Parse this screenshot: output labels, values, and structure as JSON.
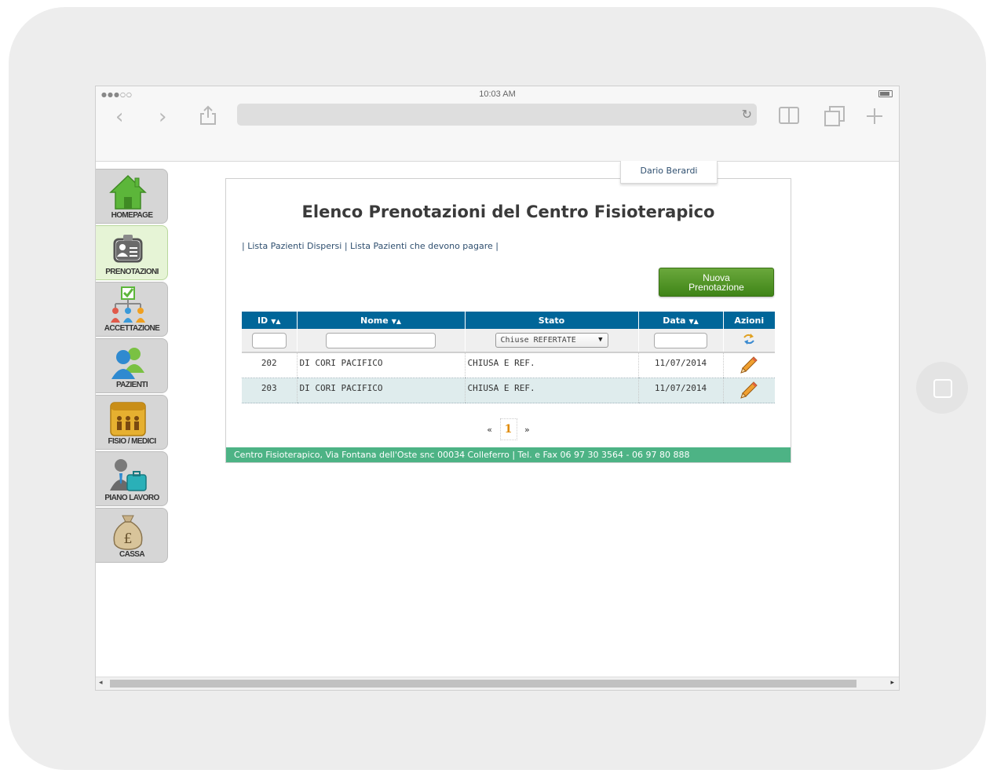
{
  "browser": {
    "signal": "●●●○○",
    "time": "10:03 AM",
    "back_icon": "‹",
    "forward_icon": "›",
    "reload_icon": "↻",
    "url": ""
  },
  "user": {
    "name": "Dario Berardi"
  },
  "sidebar": {
    "items": [
      {
        "label": "HOMEPAGE",
        "icon": "home-icon"
      },
      {
        "label": "PRENOTAZIONI",
        "icon": "id-card-icon",
        "active": true
      },
      {
        "label": "ACCETTAZIONE",
        "icon": "hierarchy-check-icon"
      },
      {
        "label": "PAZIENTI",
        "icon": "users-icon"
      },
      {
        "label": "FISIO / MEDICI",
        "icon": "team-folder-icon"
      },
      {
        "label": "PIANO LAVORO",
        "icon": "worker-briefcase-icon"
      },
      {
        "label": "CASSA",
        "icon": "money-bag-icon"
      }
    ]
  },
  "page": {
    "title": "Elenco Prenotazioni del Centro Fisioterapico",
    "links": [
      "Lista Pazienti Dispersi",
      "Lista Pazienti che devono pagare"
    ],
    "link_sep": "|",
    "new_button": {
      "line1": "Nuova",
      "line2": "Prenotazione"
    }
  },
  "table": {
    "headers": [
      "ID",
      "Nome",
      "Stato",
      "Data",
      "Azioni"
    ],
    "sort_arrows": "▼▲",
    "filter": {
      "stato_selected": "Chiuse REFERTATE",
      "select_arrow": "▼"
    },
    "rows": [
      {
        "id": "202",
        "nome": "DI CORI PACIFICO",
        "stato": "CHIUSA E REF.",
        "data": "11/07/2014"
      },
      {
        "id": "203",
        "nome": "DI CORI PACIFICO",
        "stato": "CHIUSA E REF.",
        "data": "11/07/2014"
      }
    ]
  },
  "pager": {
    "prev": "«",
    "current": "1",
    "next": "»"
  },
  "footer": {
    "text": "Centro Fisioterapico, Via Fontana dell'Oste snc 00034 Colleferro | Tel. e Fax 06 97 30 3564 - 06 97 80 888"
  },
  "scrollbar": {
    "left": "◂",
    "right": "▸"
  },
  "colors": {
    "header_blue": "#006699",
    "footer_green": "#4db385",
    "button_green": "#3f8417"
  }
}
